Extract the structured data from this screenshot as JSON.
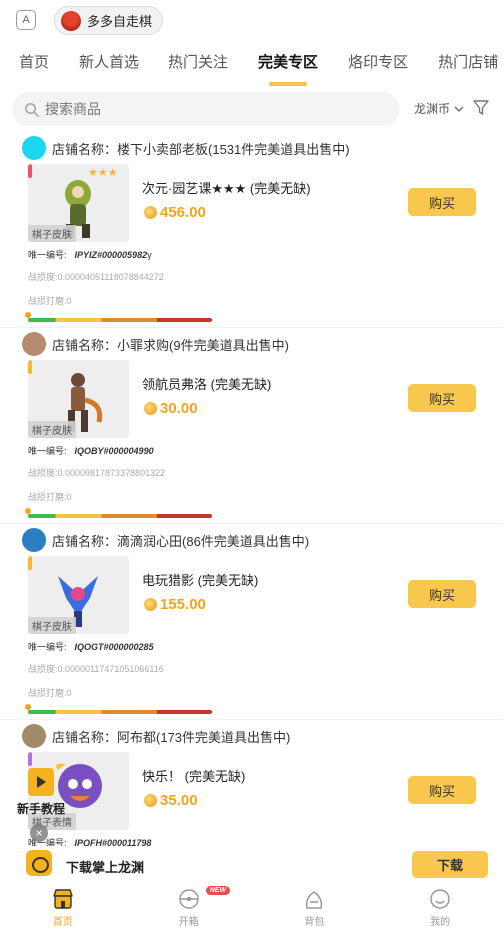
{
  "header": {
    "a_icon": "A",
    "game_name": "多多自走棋"
  },
  "tabs": [
    {
      "label": "首页"
    },
    {
      "label": "新人首选"
    },
    {
      "label": "热门关注"
    },
    {
      "label": "完美专区",
      "active": true
    },
    {
      "label": "烙印专区"
    },
    {
      "label": "热门店铺"
    }
  ],
  "search": {
    "placeholder": "搜索商品",
    "currency": "龙渊币"
  },
  "listings": [
    {
      "shop_prefix": "店铺名称：",
      "shop_name": "楼下小卖部老板(1531件完美道具出售中)",
      "avatar_color": "#1ad6f0",
      "tag_color": "#f0506e",
      "item_type": "棋子皮肤",
      "stars": "★★★",
      "item_name": "次元·园艺课★★★ (完美无缺)",
      "price": "456.00",
      "buy_label": "购买",
      "uid_label": "唯一编号:",
      "uid_value": "IPYIZ#000005982",
      "uid_suffix": "γ",
      "wear": "战损度:0.0000405111807884427​2",
      "fight": "战损打磨:0",
      "progress": 0.0
    },
    {
      "shop_prefix": "店铺名称：",
      "shop_name": "小罪求购(9件完美道具出售中)",
      "avatar_color": "#b68b71",
      "tag_color": "#f7b733",
      "item_type": "棋子皮肤",
      "stars": "",
      "item_name": "领航员弗洛 (完美无缺)",
      "price": "30.00",
      "buy_label": "购买",
      "uid_label": "唯一编号:",
      "uid_value": "IQOBY#000004990",
      "uid_suffix": "",
      "wear": "战损度:0.00009817873378801322",
      "fight": "战损打磨:0",
      "progress": 0.0
    },
    {
      "shop_prefix": "店铺名称：",
      "shop_name": "滴滴润心田(86件完美道具出售中)",
      "avatar_color": "#2a7fc4",
      "tag_color": "#f7b733",
      "item_type": "棋子皮肤",
      "stars": "",
      "item_name": "电玩猎影 (完美无缺)",
      "price": "155.00",
      "buy_label": "购买",
      "uid_label": "唯一编号:",
      "uid_value": "IQOGT#000000285",
      "uid_suffix": "",
      "wear": "战损度:0.00000117471051066116",
      "fight": "战损打磨:0",
      "progress": 0.0
    },
    {
      "shop_prefix": "店铺名称：",
      "shop_name": "阿布都(173件完美道具出售中)",
      "avatar_color": "#a08a6a",
      "tag_color": "#b36ee0",
      "item_type": "棋子表情",
      "stars": "",
      "item_name": "快乐！ (完美无缺)",
      "price": "35.00",
      "buy_label": "购买",
      "uid_label": "唯一编号:",
      "uid_value": "IPQFH#000011798",
      "uid_suffix": "",
      "wear": "",
      "fight": "",
      "progress": 0.0
    }
  ],
  "floating": {
    "tutorial_label": "新手教程",
    "close": "×"
  },
  "download": {
    "text": "下载掌上龙渊",
    "button": "下载"
  },
  "bottom_nav": [
    {
      "label": "首页",
      "icon": "shop-icon",
      "active": true
    },
    {
      "label": "开箱",
      "icon": "box-icon",
      "badge": "NEW"
    },
    {
      "label": "背包",
      "icon": "bag-icon"
    },
    {
      "label": "我的",
      "icon": "profile-icon"
    }
  ],
  "colors": {
    "accent": "#f8c74d",
    "price": "#f3a51a"
  }
}
